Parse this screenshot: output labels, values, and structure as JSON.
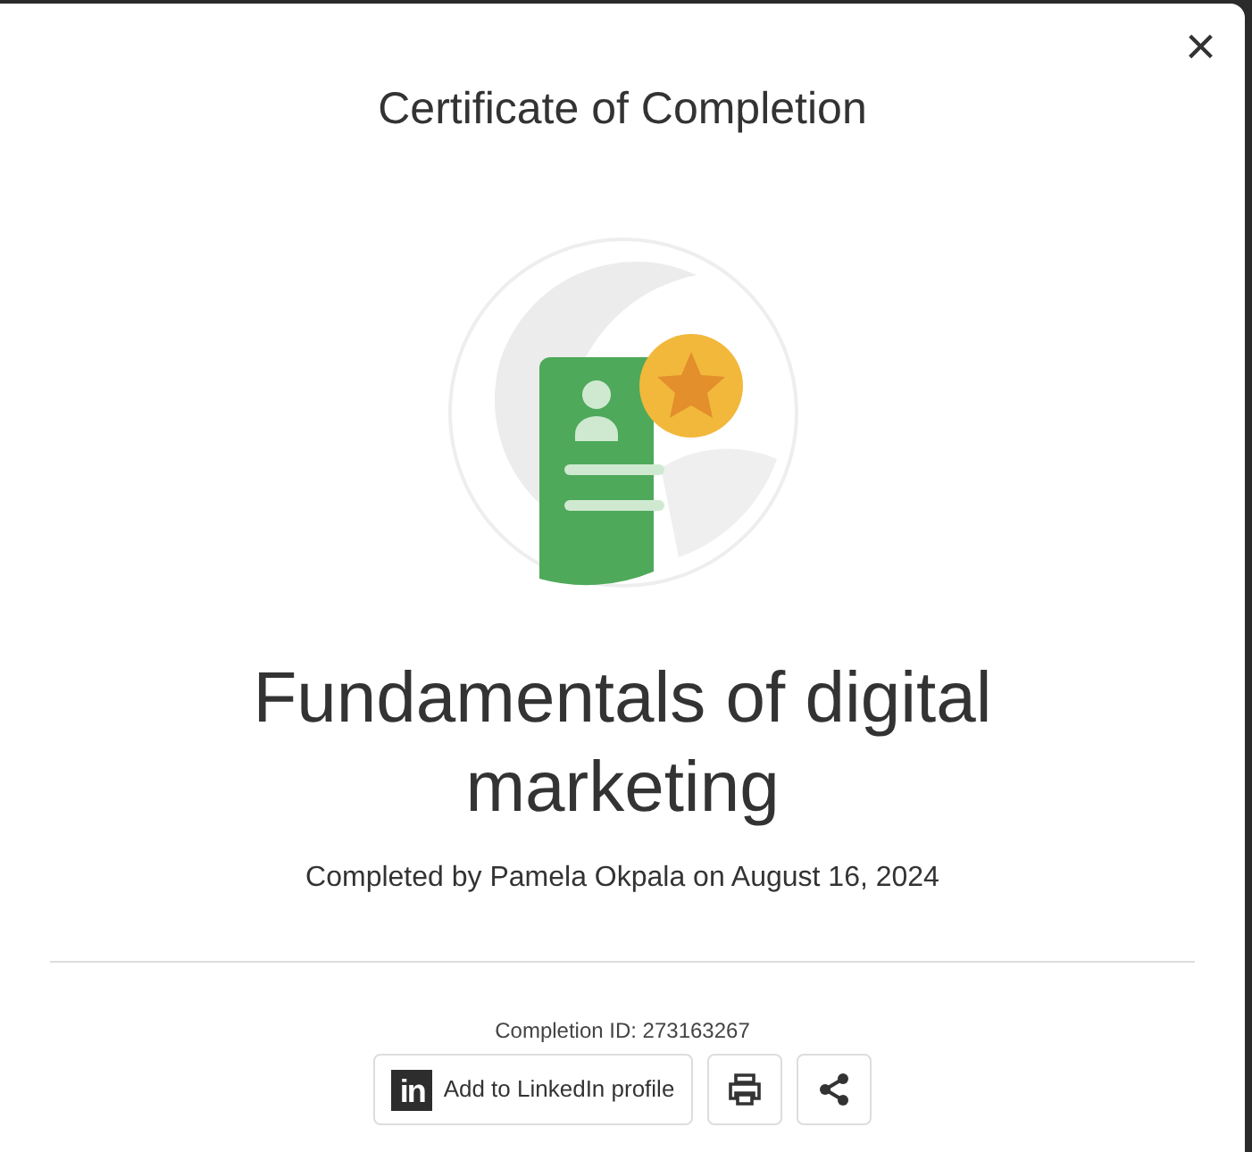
{
  "dialog": {
    "title": "Certificate of Completion",
    "close_label": "×"
  },
  "course": {
    "title": "Fundamentals of digital marketing",
    "completed_by": "Completed by Pamela Okpala on August 16, 2024"
  },
  "completion_id": "Completion ID: 273163267",
  "actions": [
    {
      "kind": "linkedin",
      "logo": "in",
      "label": "Add to LinkedIn profile"
    },
    {
      "kind": "print"
    },
    {
      "kind": "share"
    }
  ]
}
